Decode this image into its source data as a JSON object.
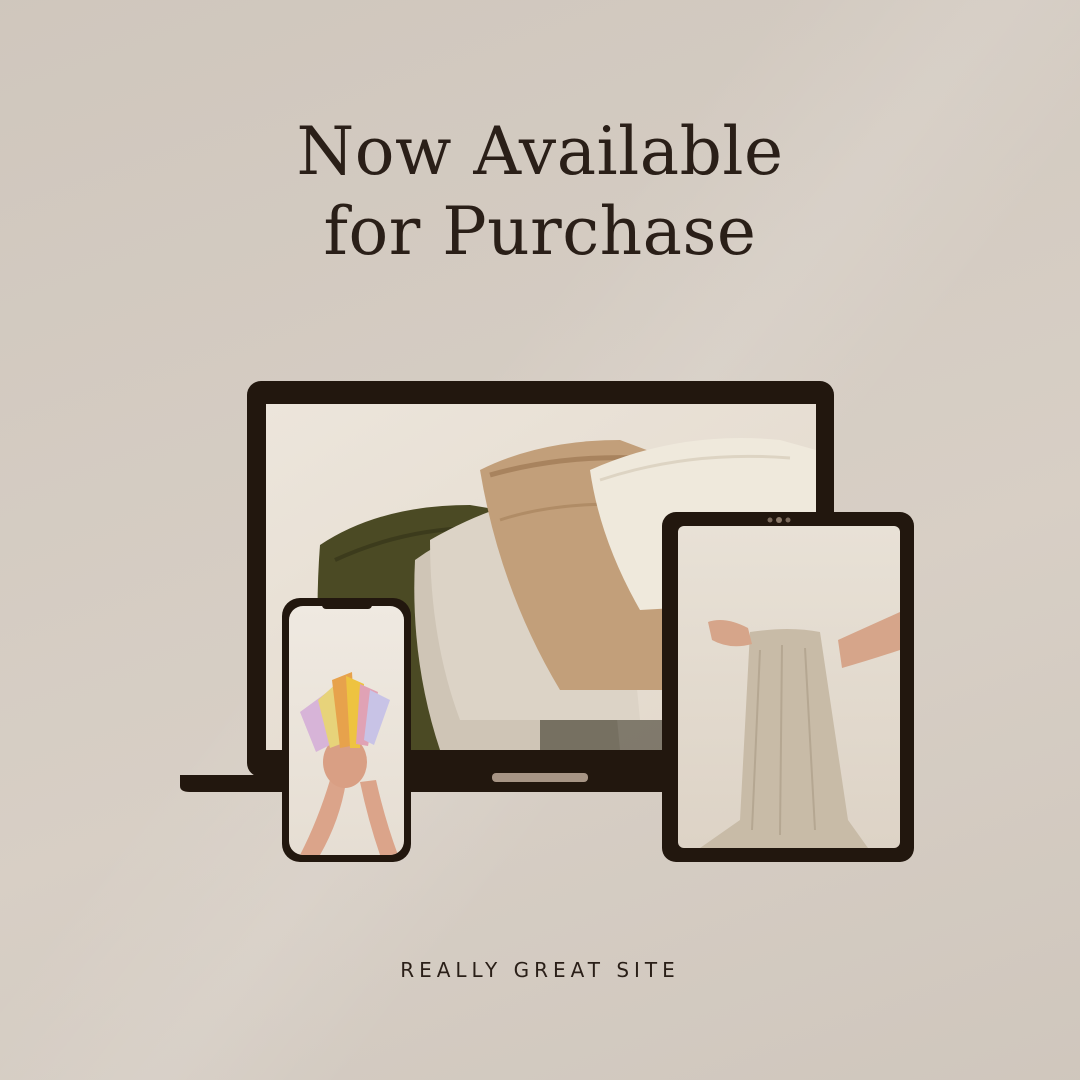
{
  "headline": {
    "line1": "Now Available",
    "line2": "for Purchase"
  },
  "footer": {
    "site": "REALLY GREAT SITE"
  },
  "colors": {
    "background": "#d6cdc3",
    "device_frame": "#22170e",
    "text": "#2a1f18"
  },
  "devices": {
    "laptop": {
      "screen_image": "folded linen fabrics (olive, beige, tan, cream)"
    },
    "tablet": {
      "screen_image": "arm holding natural linen fabric"
    },
    "phone": {
      "screen_image": "hands holding colorful fabric swatches"
    }
  }
}
